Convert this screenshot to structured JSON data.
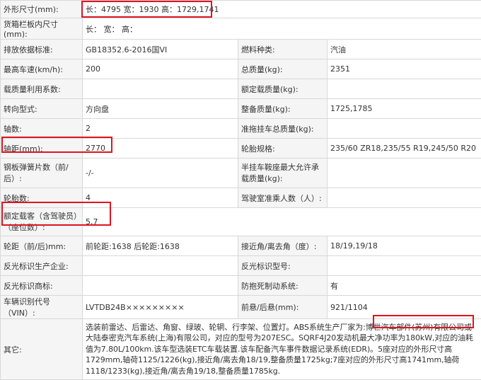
{
  "rows": {
    "dimensions": {
      "label": "外形尺寸(mm):",
      "value": "长：4795 宽：1930 高：1729,1741"
    },
    "cargo": {
      "label": "货箱栏板内尺寸(mm):",
      "value": "长：  宽：  高："
    },
    "emission": {
      "label": "排放依据标准:",
      "value": "GB18352.6-2016国VI",
      "label2": "燃料种类:",
      "value2": "汽油"
    },
    "speed": {
      "label": "最高车速(km/h):",
      "value": "200",
      "label2": "总质量(kg):",
      "value2": "2351"
    },
    "load_util": {
      "label": "载质量利用系数:",
      "value": "",
      "label2": "额定载质量(kg):",
      "value2": ""
    },
    "steering": {
      "label": "转向型式:",
      "value": "方向盘",
      "label2": "整备质量(kg):",
      "value2": "1725,1785"
    },
    "axles": {
      "label": "轴数:",
      "value": "2",
      "label2": "准拖挂车总质量(kg):",
      "value2": ""
    },
    "wheelbase": {
      "label": "轴距(mm):",
      "value": "2770",
      "label2": "轮胎规格:",
      "value2": "235/60 ZR18,235/55 R19,245/50 R20"
    },
    "springs": {
      "label": "钢板弹簧片数（前/后）:",
      "value": "-/-",
      "label2": "半挂车鞍座最大允许承载质量(kg):",
      "value2": ""
    },
    "tires": {
      "label": "轮胎数:",
      "value": "4",
      "label2": "驾驶室准乘人数（人）:",
      "value2": ""
    },
    "seats": {
      "label": "额定载客（含驾驶员）（座位数）:",
      "value": "5,7"
    },
    "track": {
      "label": "轮距（前/后)mm:",
      "value": "前轮距:1638 后轮距:1638",
      "label2": "接近角/离去角（度）:",
      "value2": "18/19,19/18"
    },
    "reflect_mfr": {
      "label": "反光标识生产企业:",
      "value": "",
      "label2": "反光标识型号:",
      "value2": ""
    },
    "reflect_mark": {
      "label": "反光标识商标:",
      "value": "",
      "label2": "防抱死制动系统:",
      "value2": "有"
    },
    "vin": {
      "label": "车辆识别代号（VIN）:",
      "value": "LVTDB24B×××××××××",
      "label2": "前悬/后悬(mm):",
      "value2": "921/1104"
    },
    "other": {
      "label": "其它:",
      "text_a": "选装前雷达、后雷达、角窗、绿玻、轮辋、行李架、位置灯。ABS系统生产厂家为:博世汽车部件(苏州)有限公司或大陆泰密克汽车系统(上海)有限公司，对应的型号为207ESC。SQRF4J20发动机最大净功率为180kW,",
      "text_highlight": "对应的油耗值为7.80L/100km.",
      "text_b": "该车型选装ETC车载装置.该车配备汽车事件数据记录系统(EDR)。5座对应的外形尺寸高1729mm,轴荷1125/1226(kg),接近角/离去角18/19,整备质量1725kg;7座对应的外形尺寸高1741mm,轴荷1118/1233(kg),接近角/离去角19/18,整备质量1785kg."
    }
  },
  "colors": {
    "highlight": "#e0131f",
    "label_bg": "#f5f5f5",
    "border": "#d8d8d8"
  }
}
